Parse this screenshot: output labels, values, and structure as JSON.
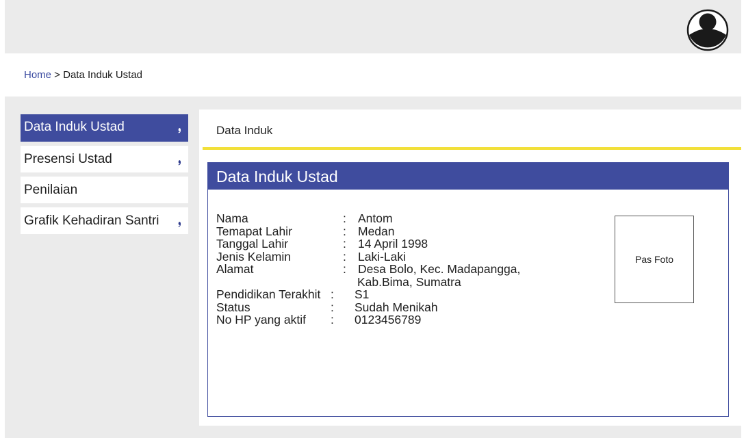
{
  "header": {
    "avatar_icon": "user-avatar-icon"
  },
  "breadcrumb": {
    "home": "Home",
    "separator": " > ",
    "current": "Data Induk Ustad"
  },
  "sidebar": {
    "items": [
      {
        "label": "Data Induk Ustad",
        "active": true,
        "has_chevron": true
      },
      {
        "label": "Presensi Ustad",
        "active": false,
        "has_chevron": true
      },
      {
        "label": "Penilaian",
        "active": false,
        "has_chevron": false
      },
      {
        "label": "Grafik Kehadiran Santri",
        "active": false,
        "has_chevron": true
      }
    ],
    "chevron_glyph": "❟"
  },
  "panel": {
    "title": "Data Induk"
  },
  "card": {
    "title": "Data Induk Ustad",
    "photo_label": "Pas Foto",
    "fields": [
      {
        "label": "Nama",
        "colon": ":",
        "value": "Antom"
      },
      {
        "label": "Temapat Lahir",
        "colon": ":",
        "value": "Medan"
      },
      {
        "label": "Tanggal Lahir",
        "colon": ":",
        "value": "14 April 1998"
      },
      {
        "label": "Jenis Kelamin",
        "colon": ":",
        "value": "Laki-Laki"
      },
      {
        "label": "Alamat",
        "colon": ":",
        "value": "Desa Bolo, Kec. Madapangga,"
      },
      {
        "label": "",
        "colon": "",
        "value": "Kab.Bima, Sumatra"
      },
      {
        "label": "Pendidikan Terakhit",
        "colon": ":",
        "value": "S1"
      },
      {
        "label": "Status",
        "colon": ":",
        "value": "Sudah Menikah"
      },
      {
        "label": "No HP yang aktif",
        "colon": ":",
        "value": "0123456789"
      }
    ]
  },
  "colors": {
    "accent": "#3f4c9e",
    "highlight": "#f2e03a",
    "background": "#ebebeb"
  }
}
